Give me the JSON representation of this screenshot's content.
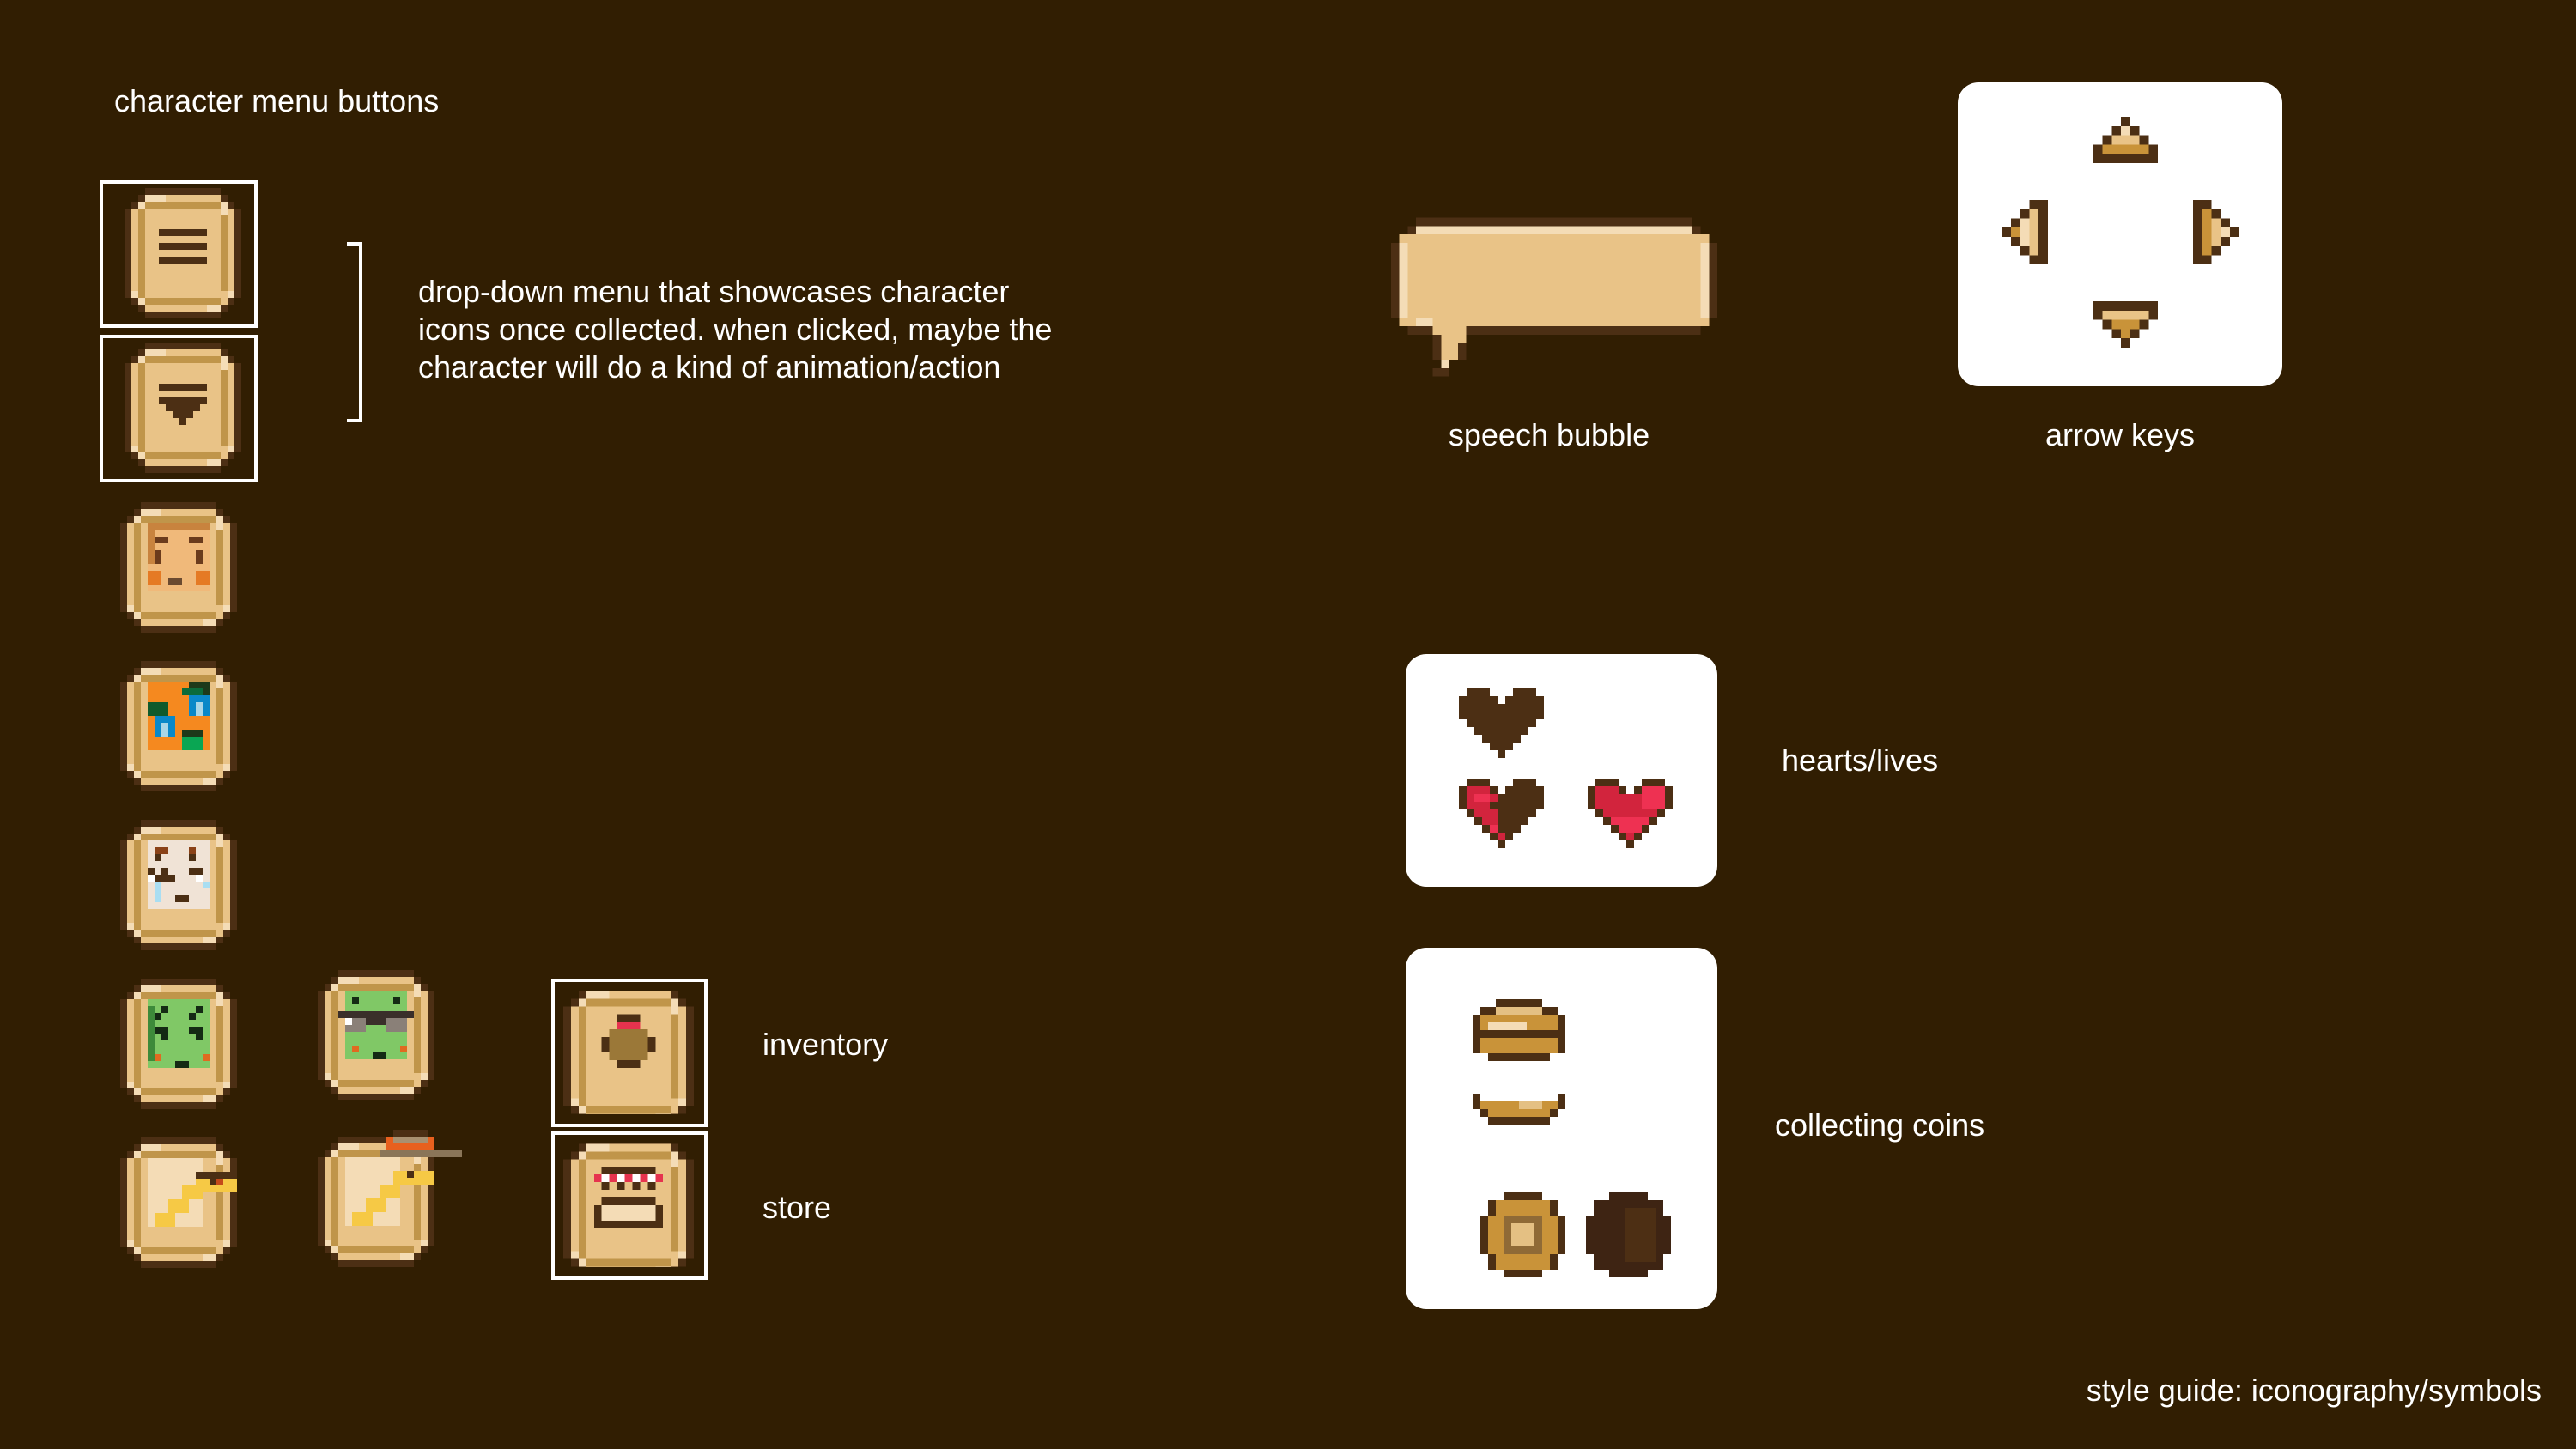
{
  "page": {
    "background_color": "#311e02",
    "footer_title": "style guide: iconography/symbols"
  },
  "character_menu": {
    "heading": "character menu buttons",
    "description_lines": [
      "drop-down menu that showcases character",
      "icons once collected. when clicked, maybe the",
      "character will do a kind of animation/action"
    ],
    "menu_buttons": [
      {
        "name": "menu-button",
        "icon": "hamburger-menu-icon"
      },
      {
        "name": "dropdown-button",
        "icon": "dropdown-arrow-icon"
      }
    ],
    "character_icons": [
      {
        "name": "character-girl",
        "icon": "girl-face-icon"
      },
      {
        "name": "character-orange-blue",
        "icon": "orange-blue-pattern-icon"
      },
      {
        "name": "character-crying-ghost",
        "icon": "crying-face-icon"
      },
      {
        "name": "character-green-frog",
        "icon": "green-face-icon"
      },
      {
        "name": "character-green-frog-glasses",
        "icon": "green-face-sunglasses-icon"
      },
      {
        "name": "character-snake",
        "icon": "yellow-snake-icon"
      },
      {
        "name": "character-snake-hat",
        "icon": "yellow-snake-hat-icon"
      }
    ]
  },
  "utility_buttons": [
    {
      "label": "inventory",
      "icon": "bag-icon"
    },
    {
      "label": "store",
      "icon": "shop-stall-icon"
    }
  ],
  "speech_bubble": {
    "label": "speech bubble"
  },
  "arrow_keys": {
    "label": "arrow keys",
    "directions": [
      "up",
      "left",
      "right",
      "down"
    ]
  },
  "hearts": {
    "label": "hearts/lives",
    "states": [
      "empty",
      "half",
      "full"
    ]
  },
  "coins": {
    "label": "collecting coins",
    "states": [
      "coin-stack-top",
      "coin-stack-bottom",
      "coin-gold",
      "coin-dark"
    ]
  },
  "palette": {
    "tan": "#e9c387",
    "tan_light": "#f4dcb6",
    "tan_mid": "#c0954a",
    "outline": "#4c2f14",
    "heart_red": "#d2243d",
    "heart_red_light": "#ee3152",
    "coin_gold": "#c99339"
  }
}
